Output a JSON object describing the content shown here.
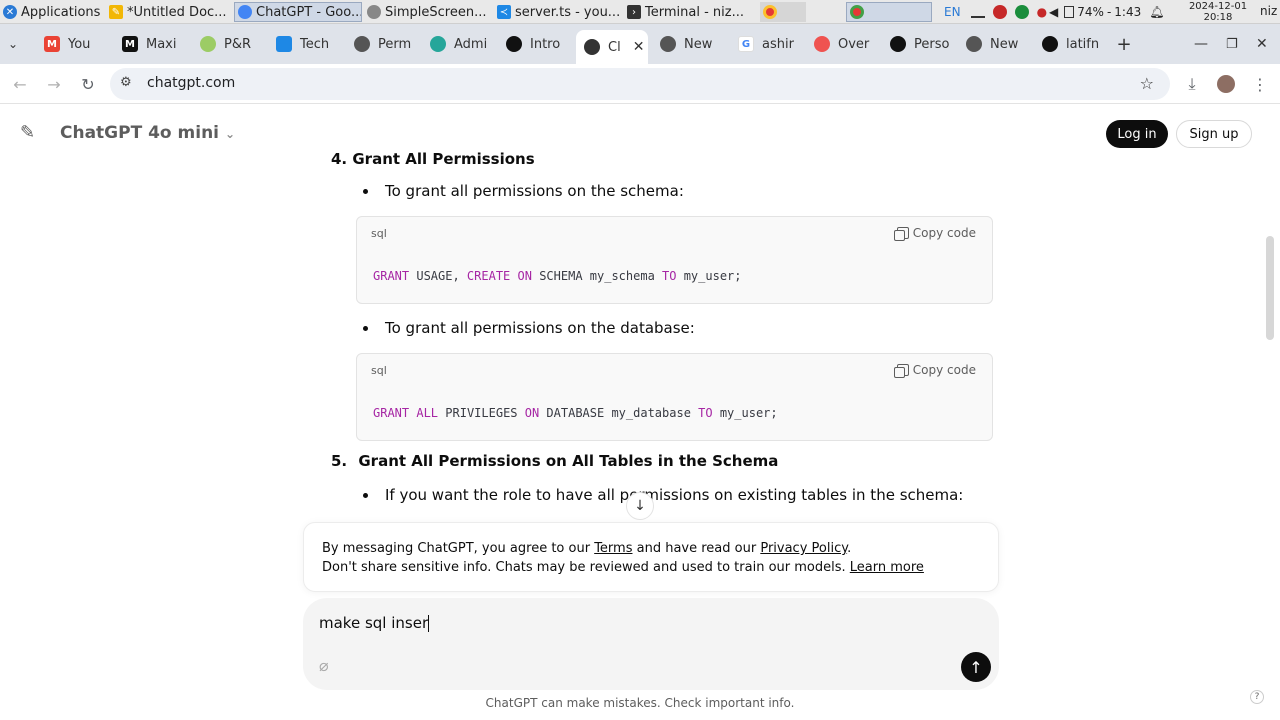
{
  "taskbar": {
    "items": [
      {
        "label": "Applications ⋮",
        "color": "#2a7ad5"
      },
      {
        "label": "*Untitled Doc...",
        "color": "#f2b705"
      },
      {
        "label": "ChatGPT - Goo...",
        "color": "#4285f4"
      },
      {
        "label": "SimpleScreen...",
        "color": "#888888"
      },
      {
        "label": "server.ts - you...",
        "color": "#1e88e5"
      },
      {
        "label": "Terminal - niz...",
        "color": "#333333"
      }
    ],
    "tray": {
      "lang": "EN",
      "battery": "74%",
      "battery_time": "1:43",
      "date": "2024-12-01",
      "time": "20:18",
      "user": "niz"
    }
  },
  "browser": {
    "tabs": [
      {
        "label": "You",
        "icon": "gmail-icon"
      },
      {
        "label": "Maxi",
        "icon": "maxi-icon"
      },
      {
        "label": "P&R",
        "icon": "pr-icon"
      },
      {
        "label": "Tech",
        "icon": "tech-icon"
      },
      {
        "label": "Perm",
        "icon": "perm-icon"
      },
      {
        "label": "Admi",
        "icon": "admin-icon"
      },
      {
        "label": "Intro",
        "icon": "intro-icon"
      },
      {
        "label": "Cl",
        "icon": "chatgpt-icon",
        "active": true
      },
      {
        "label": "New",
        "icon": "new-icon"
      },
      {
        "label": "ashir",
        "icon": "google-icon"
      },
      {
        "label": "Over",
        "icon": "over-icon"
      },
      {
        "label": "Perso",
        "icon": "github-icon"
      },
      {
        "label": "New",
        "icon": "new-icon"
      },
      {
        "label": "latifn",
        "icon": "github-icon"
      }
    ],
    "url": "chatgpt.com"
  },
  "page": {
    "model": "ChatGPT 4o mini",
    "login": "Log in",
    "signup": "Sign up",
    "section4_title": "4. Grant All Permissions",
    "bullet1": "To grant all permissions on the schema:",
    "code1": {
      "lang": "sql",
      "copy": "Copy code",
      "t1": "GRANT",
      "t2": " USAGE, ",
      "t3": "CREATE",
      "t4": " ",
      "t5": "ON",
      "t6": " SCHEMA my_schema ",
      "t7": "TO",
      "t8": " my_user;"
    },
    "bullet2": "To grant all permissions on the database:",
    "code2": {
      "lang": "sql",
      "copy": "Copy code",
      "t1": "GRANT",
      "t2": " ",
      "t3": "ALL",
      "t4": " PRIVILEGES ",
      "t5": "ON",
      "t6": " DATABASE my_database ",
      "t7": "TO",
      "t8": " my_user;"
    },
    "section5_num": "5.",
    "section5_title": "Grant All Permissions on All Tables in the Schema",
    "bullet3": "If you want the role to have all permissions on existing tables in the schema:",
    "notice": {
      "l1a": "By messaging ChatGPT, you agree to our ",
      "terms": "Terms",
      "l1b": " and have read our ",
      "privacy": "Privacy Policy",
      "l1c": ".",
      "l2": "Don't share sensitive info. Chats may be reviewed and used to train our models. ",
      "learn": "Learn more"
    },
    "composer_value": "make sql inser",
    "footer": "ChatGPT can make mistakes. Check important info.",
    "help": "?"
  }
}
